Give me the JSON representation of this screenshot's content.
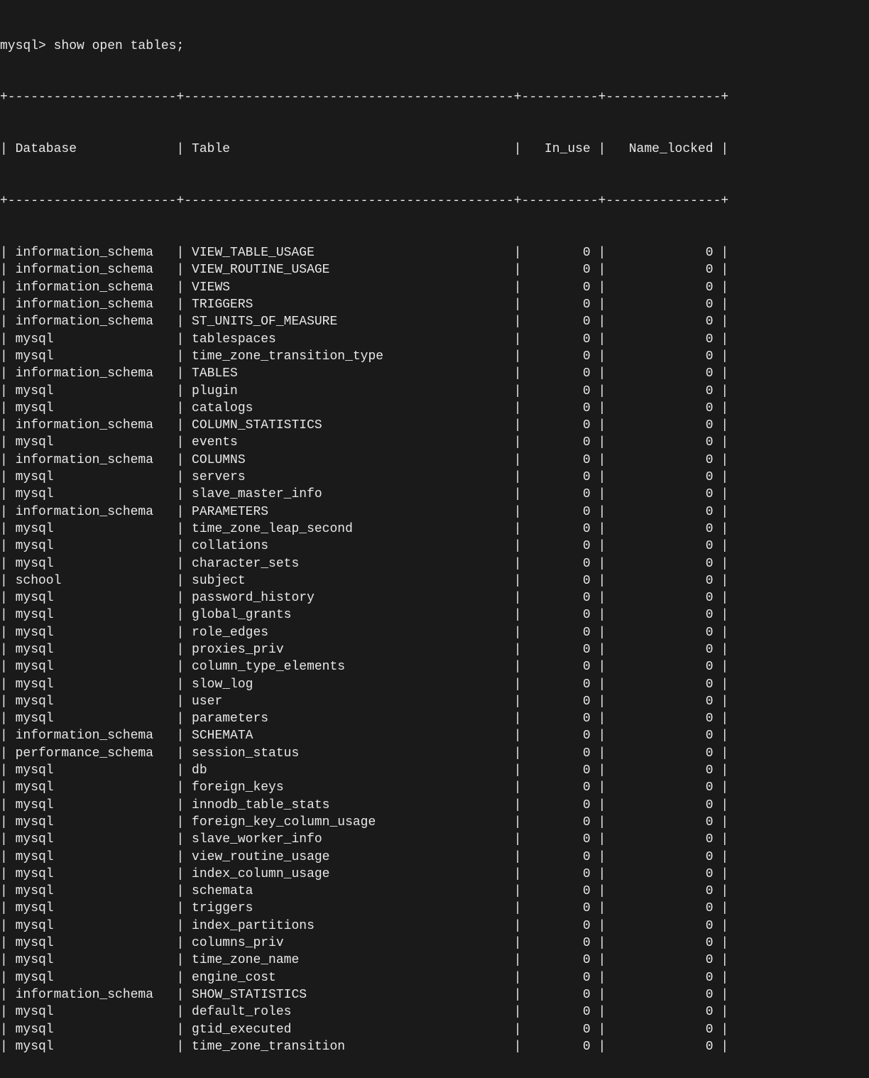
{
  "prompt": "mysql> show open tables;",
  "columns": [
    "Database",
    "Table",
    "In_use",
    "Name_locked"
  ],
  "rows": [
    {
      "db": "information_schema",
      "table": "VIEW_TABLE_USAGE",
      "in_use": 0,
      "name_locked": 0
    },
    {
      "db": "information_schema",
      "table": "VIEW_ROUTINE_USAGE",
      "in_use": 0,
      "name_locked": 0
    },
    {
      "db": "information_schema",
      "table": "VIEWS",
      "in_use": 0,
      "name_locked": 0
    },
    {
      "db": "information_schema",
      "table": "TRIGGERS",
      "in_use": 0,
      "name_locked": 0
    },
    {
      "db": "information_schema",
      "table": "ST_UNITS_OF_MEASURE",
      "in_use": 0,
      "name_locked": 0
    },
    {
      "db": "mysql",
      "table": "tablespaces",
      "in_use": 0,
      "name_locked": 0
    },
    {
      "db": "mysql",
      "table": "time_zone_transition_type",
      "in_use": 0,
      "name_locked": 0
    },
    {
      "db": "information_schema",
      "table": "TABLES",
      "in_use": 0,
      "name_locked": 0
    },
    {
      "db": "mysql",
      "table": "plugin",
      "in_use": 0,
      "name_locked": 0
    },
    {
      "db": "mysql",
      "table": "catalogs",
      "in_use": 0,
      "name_locked": 0
    },
    {
      "db": "information_schema",
      "table": "COLUMN_STATISTICS",
      "in_use": 0,
      "name_locked": 0
    },
    {
      "db": "mysql",
      "table": "events",
      "in_use": 0,
      "name_locked": 0
    },
    {
      "db": "information_schema",
      "table": "COLUMNS",
      "in_use": 0,
      "name_locked": 0
    },
    {
      "db": "mysql",
      "table": "servers",
      "in_use": 0,
      "name_locked": 0
    },
    {
      "db": "mysql",
      "table": "slave_master_info",
      "in_use": 0,
      "name_locked": 0
    },
    {
      "db": "information_schema",
      "table": "PARAMETERS",
      "in_use": 0,
      "name_locked": 0
    },
    {
      "db": "mysql",
      "table": "time_zone_leap_second",
      "in_use": 0,
      "name_locked": 0
    },
    {
      "db": "mysql",
      "table": "collations",
      "in_use": 0,
      "name_locked": 0
    },
    {
      "db": "mysql",
      "table": "character_sets",
      "in_use": 0,
      "name_locked": 0
    },
    {
      "db": "school",
      "table": "subject",
      "in_use": 0,
      "name_locked": 0
    },
    {
      "db": "mysql",
      "table": "password_history",
      "in_use": 0,
      "name_locked": 0
    },
    {
      "db": "mysql",
      "table": "global_grants",
      "in_use": 0,
      "name_locked": 0
    },
    {
      "db": "mysql",
      "table": "role_edges",
      "in_use": 0,
      "name_locked": 0
    },
    {
      "db": "mysql",
      "table": "proxies_priv",
      "in_use": 0,
      "name_locked": 0
    },
    {
      "db": "mysql",
      "table": "column_type_elements",
      "in_use": 0,
      "name_locked": 0
    },
    {
      "db": "mysql",
      "table": "slow_log",
      "in_use": 0,
      "name_locked": 0
    },
    {
      "db": "mysql",
      "table": "user",
      "in_use": 0,
      "name_locked": 0
    },
    {
      "db": "mysql",
      "table": "parameters",
      "in_use": 0,
      "name_locked": 0
    },
    {
      "db": "information_schema",
      "table": "SCHEMATA",
      "in_use": 0,
      "name_locked": 0
    },
    {
      "db": "performance_schema",
      "table": "session_status",
      "in_use": 0,
      "name_locked": 0
    },
    {
      "db": "mysql",
      "table": "db",
      "in_use": 0,
      "name_locked": 0
    },
    {
      "db": "mysql",
      "table": "foreign_keys",
      "in_use": 0,
      "name_locked": 0
    },
    {
      "db": "mysql",
      "table": "innodb_table_stats",
      "in_use": 0,
      "name_locked": 0
    },
    {
      "db": "mysql",
      "table": "foreign_key_column_usage",
      "in_use": 0,
      "name_locked": 0
    },
    {
      "db": "mysql",
      "table": "slave_worker_info",
      "in_use": 0,
      "name_locked": 0
    },
    {
      "db": "mysql",
      "table": "view_routine_usage",
      "in_use": 0,
      "name_locked": 0
    },
    {
      "db": "mysql",
      "table": "index_column_usage",
      "in_use": 0,
      "name_locked": 0
    },
    {
      "db": "mysql",
      "table": "schemata",
      "in_use": 0,
      "name_locked": 0
    },
    {
      "db": "mysql",
      "table": "triggers",
      "in_use": 0,
      "name_locked": 0
    },
    {
      "db": "mysql",
      "table": "index_partitions",
      "in_use": 0,
      "name_locked": 0
    },
    {
      "db": "mysql",
      "table": "columns_priv",
      "in_use": 0,
      "name_locked": 0
    },
    {
      "db": "mysql",
      "table": "time_zone_name",
      "in_use": 0,
      "name_locked": 0
    },
    {
      "db": "mysql",
      "table": "engine_cost",
      "in_use": 0,
      "name_locked": 0
    },
    {
      "db": "information_schema",
      "table": "SHOW_STATISTICS",
      "in_use": 0,
      "name_locked": 0
    },
    {
      "db": "mysql",
      "table": "default_roles",
      "in_use": 0,
      "name_locked": 0
    },
    {
      "db": "mysql",
      "table": "gtid_executed",
      "in_use": 0,
      "name_locked": 0
    },
    {
      "db": "mysql",
      "table": "time_zone_transition",
      "in_use": 0,
      "name_locked": 0
    }
  ],
  "sep": {
    "corner": "+",
    "dash": "-",
    "widths": [
      22,
      43,
      10,
      15
    ]
  }
}
